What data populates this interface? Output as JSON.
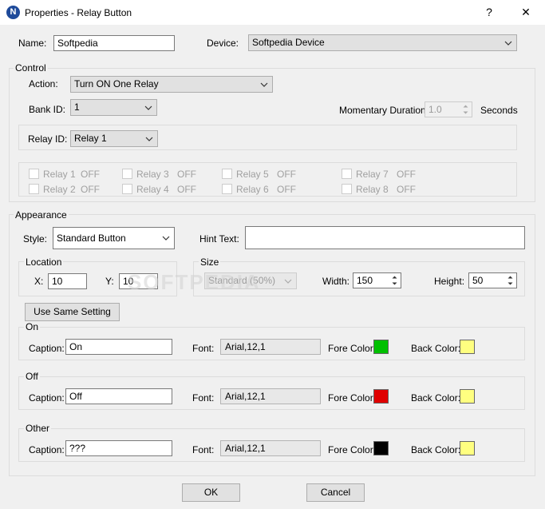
{
  "window": {
    "title": "Properties - Relay Button",
    "icon_letter": "N",
    "help_glyph": "?",
    "close_glyph": "✕"
  },
  "top": {
    "name_label": "Name:",
    "name_value": "Softpedia",
    "device_label": "Device:",
    "device_value": "Softpedia Device"
  },
  "control": {
    "group_title": "Control",
    "action_label": "Action:",
    "action_value": "Turn ON One Relay",
    "bank_label": "Bank ID:",
    "bank_value": "1",
    "momentary_label": "Momentary Duration:",
    "momentary_value": "1.0",
    "seconds_label": "Seconds",
    "relay_label": "Relay ID:",
    "relay_value": "Relay 1",
    "relays": [
      {
        "label": "Relay 1",
        "state": "OFF"
      },
      {
        "label": "Relay 2",
        "state": "OFF"
      },
      {
        "label": "Relay 3",
        "state": "OFF"
      },
      {
        "label": "Relay 4",
        "state": "OFF"
      },
      {
        "label": "Relay 5",
        "state": "OFF"
      },
      {
        "label": "Relay 6",
        "state": "OFF"
      },
      {
        "label": "Relay 7",
        "state": "OFF"
      },
      {
        "label": "Relay 8",
        "state": "OFF"
      }
    ]
  },
  "appearance": {
    "group_title": "Appearance",
    "style_label": "Style:",
    "style_value": "Standard Button",
    "hint_label": "Hint Text:",
    "hint_value": "",
    "location_title": "Location",
    "x_label": "X:",
    "x_value": "10",
    "y_label": "Y:",
    "y_value": "10",
    "size_title": "Size",
    "size_value": "Standard (50%)",
    "width_label": "Width:",
    "width_value": "150",
    "height_label": "Height:",
    "height_value": "50",
    "same_setting_label": "Use Same Setting"
  },
  "states": [
    {
      "title": "On",
      "caption_label": "Caption:",
      "caption": "On",
      "font_label": "Font:",
      "font": "Arial,12,1",
      "fore_label": "Fore Color:",
      "fore_color": "#00c000",
      "back_label": "Back Color:",
      "back_color": "#ffff80"
    },
    {
      "title": "Off",
      "caption_label": "Caption:",
      "caption": "Off",
      "font_label": "Font:",
      "font": "Arial,12,1",
      "fore_label": "Fore Color:",
      "fore_color": "#e00000",
      "back_label": "Back Color:",
      "back_color": "#ffff80"
    },
    {
      "title": "Other",
      "caption_label": "Caption:",
      "caption": "???",
      "font_label": "Font:",
      "font": "Arial,12,1",
      "fore_label": "Fore Color:",
      "fore_color": "#000000",
      "back_label": "Back Color:",
      "back_color": "#ffff80"
    }
  ],
  "footer": {
    "ok_label": "OK",
    "cancel_label": "Cancel"
  },
  "watermark": "SOFTPEDIA"
}
